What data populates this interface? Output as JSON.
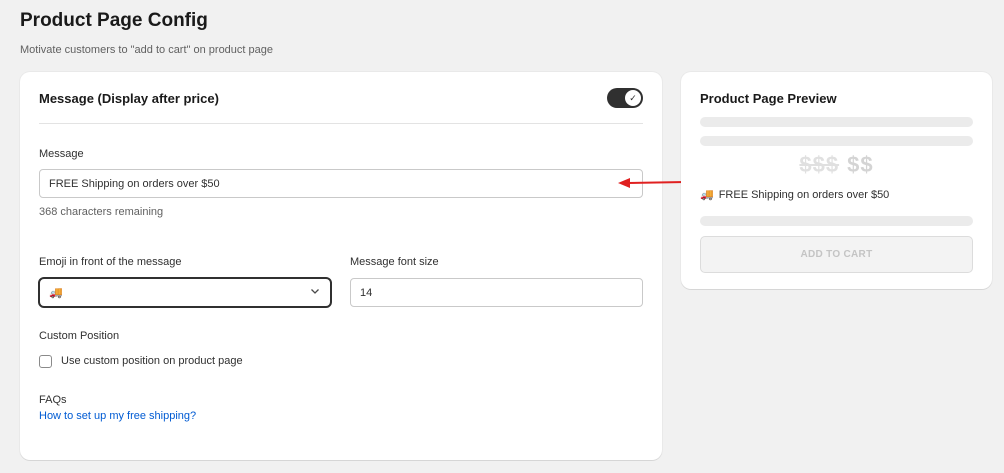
{
  "header": {
    "title": "Product Page Config",
    "subtitle": "Motivate customers to \"add to cart\" on product page"
  },
  "message_card": {
    "heading": "Message (Display after price)",
    "toggle_on": true,
    "message_label": "Message",
    "message_value": "FREE Shipping on orders over $50",
    "chars_remaining": "368 characters remaining",
    "emoji_label": "Emoji in front of the message",
    "emoji_value": "🚚",
    "font_size_label": "Message font size",
    "font_size_value": "14",
    "custom_position_label": "Custom Position",
    "custom_position_checkbox_label": "Use custom position on product page",
    "custom_position_checked": false,
    "faqs_label": "FAQs",
    "faq_link": "How to set up my free shipping?"
  },
  "preview": {
    "title": "Product Page Preview",
    "price_old": "$$$",
    "price_new": "$$",
    "message_emoji": "🚚",
    "message_text": "FREE Shipping on orders over $50",
    "add_to_cart_label": "ADD TO CART"
  },
  "colors": {
    "accent_dark": "#303030",
    "link": "#005bd3",
    "annotation_arrow": "#e02020"
  }
}
